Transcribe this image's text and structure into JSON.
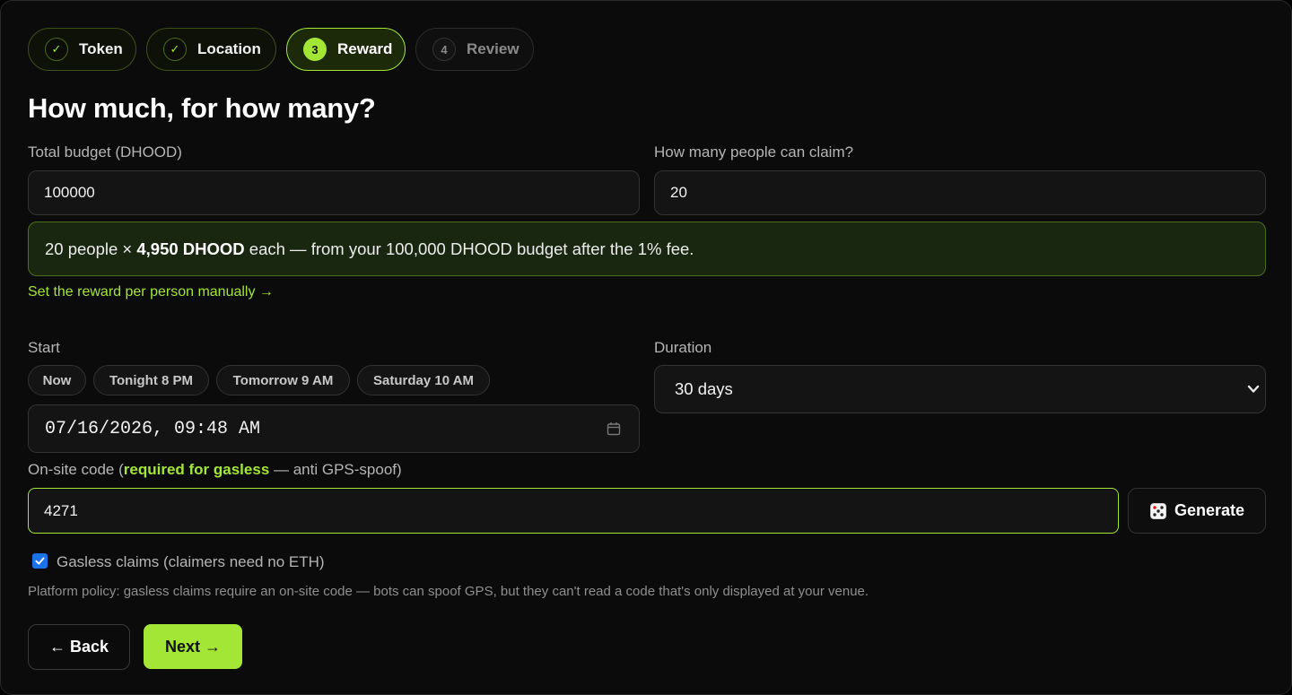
{
  "stepper": [
    {
      "badge": "✓",
      "label": "Token",
      "state": "done"
    },
    {
      "badge": "✓",
      "label": "Location",
      "state": "done"
    },
    {
      "badge": "3",
      "label": "Reward",
      "state": "current"
    },
    {
      "badge": "4",
      "label": "Review",
      "state": "pending"
    }
  ],
  "heading": "How much, for how many?",
  "budget": {
    "label": "Total budget (DHOOD)",
    "value": "100000"
  },
  "claimers": {
    "label": "How many people can claim?",
    "value": "20"
  },
  "summary": {
    "part1": "20 people × ",
    "bold": "4,950 DHOOD",
    "part2": " each — from your 100,000 DHOOD budget after the 1% fee."
  },
  "manual_link": "Set the reward per person manually →",
  "start": {
    "label": "Start",
    "presets": [
      "Now",
      "Tonight 8 PM",
      "Tomorrow 9 AM",
      "Saturday 10 AM"
    ],
    "value": "07/16/2026, 09:48 AM"
  },
  "duration": {
    "label": "Duration",
    "value": "30 days"
  },
  "onsite_code": {
    "label_prefix": "On-site code (",
    "label_required": "required for gasless",
    "label_suffix": " — anti GPS-spoof)",
    "value": "4271",
    "generate_label": "Generate"
  },
  "gasless": {
    "checked": true,
    "label": "Gasless claims (claimers need no ETH)"
  },
  "policy": "Platform policy: gasless claims require an on-site code — bots can spoof GPS, but they can't read a code that's only displayed at your venue.",
  "nav": {
    "back": "← Back",
    "next": "Next →"
  },
  "colors": {
    "accent": "#a3e635",
    "background": "#0b0b0b",
    "summary_bg": "#1a2710"
  }
}
